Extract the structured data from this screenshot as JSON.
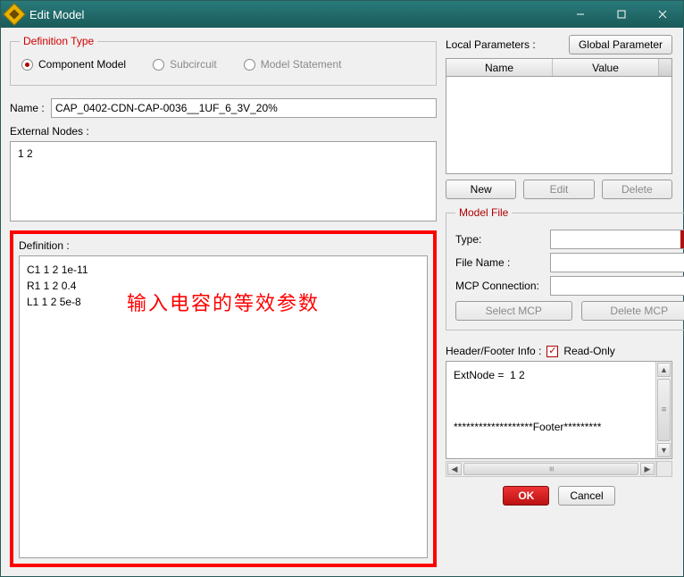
{
  "window": {
    "title": "Edit Model"
  },
  "definition_type": {
    "legend": "Definition Type",
    "options": [
      {
        "label": "Component Model",
        "selected": true,
        "enabled": true
      },
      {
        "label": "Subcircuit",
        "selected": false,
        "enabled": false
      },
      {
        "label": "Model Statement",
        "selected": false,
        "enabled": false
      }
    ]
  },
  "name": {
    "label": "Name :",
    "value": "CAP_0402-CDN-CAP-0036__1UF_6_3V_20%"
  },
  "external_nodes": {
    "label": "External Nodes :",
    "value": "1   2"
  },
  "definition": {
    "label": "Definition :",
    "lines": [
      "C1 1 2 1e-11",
      "R1 1 2 0.4",
      "L1 1 2 5e-8"
    ],
    "annotation": "输入电容的等效参数"
  },
  "local_params": {
    "label": "Local Parameters :",
    "global_btn": "Global Parameter",
    "columns": [
      "Name",
      "Value"
    ],
    "rows": [],
    "buttons": {
      "new": "New",
      "edit": "Edit",
      "delete": "Delete"
    }
  },
  "model_file": {
    "legend": "Model File",
    "type_label": "Type:",
    "type_value": "",
    "filename_label": "File Name :",
    "filename_value": "",
    "mcp_label": "MCP Connection:",
    "mcp_value": "",
    "select_mcp": "Select MCP",
    "delete_mcp": "Delete MCP"
  },
  "header_footer": {
    "label": "Header/Footer Info :",
    "readonly_label": "Read-Only",
    "readonly_checked": true,
    "text": "ExtNode =  1 2\n\n\n*******************Footer*********"
  },
  "dialog_buttons": {
    "ok": "OK",
    "cancel": "Cancel"
  }
}
